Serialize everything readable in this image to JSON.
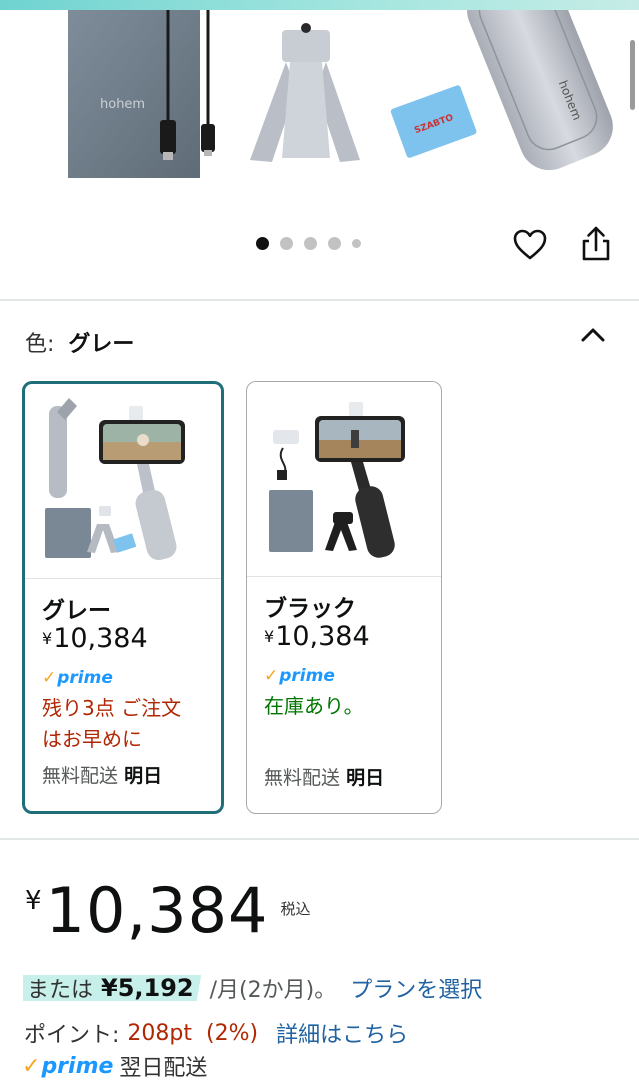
{
  "hero": {
    "image_text": [
      "hohem",
      "SZABTO",
      "hohem"
    ],
    "carousel_count": 5,
    "carousel_active": 0
  },
  "actions": {
    "wishlist_icon": "heart-outline-icon",
    "share_icon": "share-icon"
  },
  "color_selector": {
    "label": "色:",
    "selected_value": "グレー",
    "collapse_icon": "chevron-up-icon"
  },
  "variants": [
    {
      "name": "グレー",
      "currency": "¥",
      "price": "10,384",
      "prime": "prime",
      "stock_line1": "残り3点 ご注文",
      "stock_line2": "はお早めに",
      "shipping_prefix": "無料配送",
      "shipping_day": "明日",
      "selected": true
    },
    {
      "name": "ブラック",
      "currency": "¥",
      "price": "10,384",
      "prime": "prime",
      "stock_line1": "在庫あり。",
      "shipping_prefix": "無料配送",
      "shipping_day": "明日",
      "selected": false
    }
  ],
  "price": {
    "currency": "¥",
    "amount": "10,384",
    "tax_label": "税込"
  },
  "installment": {
    "prefix": "または",
    "amount": "¥5,192",
    "period": "/月(2か月)。",
    "plan_link": "プランを選択"
  },
  "points": {
    "label": "ポイント:",
    "value": "208pt",
    "percent": "(2%)",
    "details_link": "詳細はこちら"
  },
  "delivery": {
    "prime": "prime",
    "text": "翌日配送"
  },
  "colors": {
    "selected_border": "#1e6f7a",
    "prime_blue": "#1a98ff",
    "link_blue": "#2162a1",
    "warning_red": "#b12704",
    "in_stock_green": "#007600",
    "install_highlight": "#c8f0ea"
  }
}
